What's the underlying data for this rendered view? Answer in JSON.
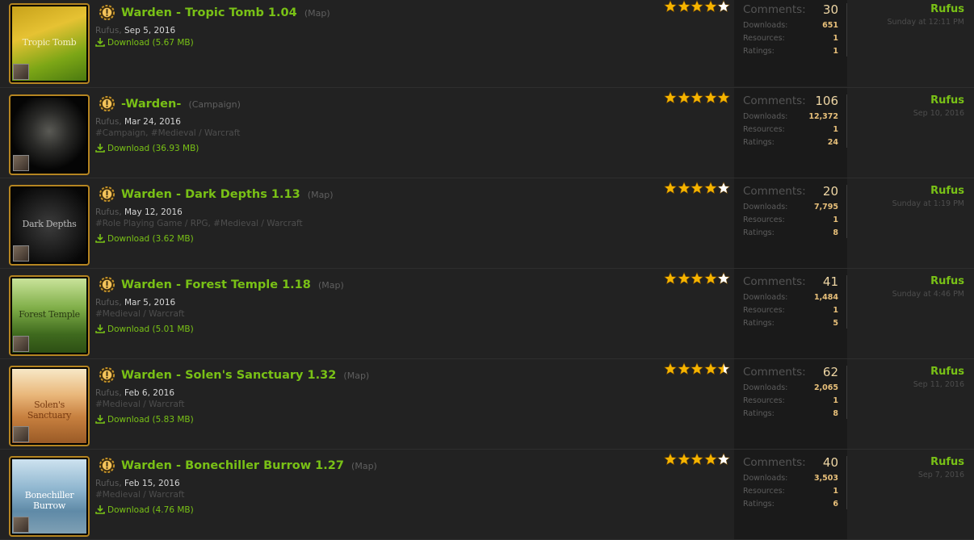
{
  "resources": [
    {
      "title": "Warden - Tropic Tomb 1.04",
      "type": "(Map)",
      "author": "Rufus",
      "date": "Sep 5, 2016",
      "tags": "",
      "download": "Download (5.67 MB)",
      "thumb_text": "Tropic Tomb",
      "rating": 4,
      "comments_label": "Comments:",
      "comments": "30",
      "downloads_label": "Downloads:",
      "downloads": "651",
      "resources_label": "Resources:",
      "resources": "1",
      "ratings_label": "Ratings:",
      "ratings": "1",
      "last_user": "Rufus",
      "last_time": "Sunday at 12:11 PM"
    },
    {
      "title": "-Warden-",
      "type": "(Campaign)",
      "author": "Rufus",
      "date": "Mar 24, 2016",
      "tags": "#Campaign, #Medieval / Warcraft",
      "download": "Download (36.93 MB)",
      "thumb_text": "",
      "rating": 5,
      "comments_label": "Comments:",
      "comments": "106",
      "downloads_label": "Downloads:",
      "downloads": "12,372",
      "resources_label": "Resources:",
      "resources": "1",
      "ratings_label": "Ratings:",
      "ratings": "24",
      "last_user": "Rufus",
      "last_time": "Sep 10, 2016"
    },
    {
      "title": "Warden - Dark Depths 1.13",
      "type": "(Map)",
      "author": "Rufus",
      "date": "May 12, 2016",
      "tags": "#Role Playing Game / RPG, #Medieval / Warcraft",
      "download": "Download (3.62 MB)",
      "thumb_text": "Dark Depths",
      "rating": 4,
      "comments_label": "Comments:",
      "comments": "20",
      "downloads_label": "Downloads:",
      "downloads": "7,795",
      "resources_label": "Resources:",
      "resources": "1",
      "ratings_label": "Ratings:",
      "ratings": "8",
      "last_user": "Rufus",
      "last_time": "Sunday at 1:19 PM"
    },
    {
      "title": "Warden - Forest Temple 1.18",
      "type": "(Map)",
      "author": "Rufus",
      "date": "Mar 5, 2016",
      "tags": "#Medieval / Warcraft",
      "download": "Download (5.01 MB)",
      "thumb_text": "Forest Temple",
      "rating": 4,
      "comments_label": "Comments:",
      "comments": "41",
      "downloads_label": "Downloads:",
      "downloads": "1,484",
      "resources_label": "Resources:",
      "resources": "1",
      "ratings_label": "Ratings:",
      "ratings": "5",
      "last_user": "Rufus",
      "last_time": "Sunday at 4:46 PM"
    },
    {
      "title": "Warden - Solen's Sanctuary 1.32",
      "type": "(Map)",
      "author": "Rufus",
      "date": "Feb 6, 2016",
      "tags": "#Medieval / Warcraft",
      "download": "Download (5.83 MB)",
      "thumb_text": "Solen's Sanctuary",
      "rating": 4.5,
      "comments_label": "Comments:",
      "comments": "62",
      "downloads_label": "Downloads:",
      "downloads": "2,065",
      "resources_label": "Resources:",
      "resources": "1",
      "ratings_label": "Ratings:",
      "ratings": "8",
      "last_user": "Rufus",
      "last_time": "Sep 11, 2016"
    },
    {
      "title": "Warden - Bonechiller Burrow 1.27",
      "type": "(Map)",
      "author": "Rufus",
      "date": "Feb 15, 2016",
      "tags": "#Medieval / Warcraft",
      "download": "Download (4.76 MB)",
      "thumb_text": "Bonechiller Burrow",
      "rating": 4,
      "comments_label": "Comments:",
      "comments": "40",
      "downloads_label": "Downloads:",
      "downloads": "3,503",
      "resources_label": "Resources:",
      "resources": "1",
      "ratings_label": "Ratings:",
      "ratings": "6",
      "last_user": "Rufus",
      "last_time": "Sep 7, 2016"
    }
  ],
  "colors": {
    "accent_green": "#79c116",
    "thumb_border": "#b58521",
    "star_fill": "#f5b400",
    "star_empty": "#ffffff"
  },
  "thumb_art": [
    "tropic",
    "warden-helm",
    "dark-depths",
    "forest",
    "desert",
    "ice-mountain"
  ]
}
